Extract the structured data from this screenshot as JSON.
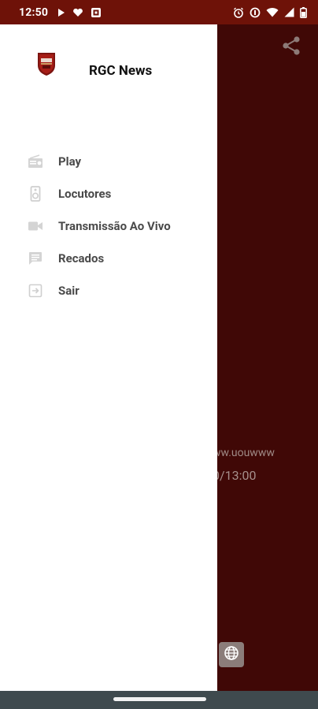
{
  "status_bar": {
    "time": "12:50",
    "left_icons": [
      "play-icon",
      "heart-shield-icon",
      "app-badge-icon"
    ],
    "right_icons": [
      "alarm-icon",
      "data-saver-icon",
      "wifi-icon",
      "signal-icon",
      "battery-icon"
    ]
  },
  "drawer": {
    "app_title": "RGC News",
    "menu_items": [
      {
        "label": "Play",
        "icon": "radio-icon"
      },
      {
        "label": "Locutores",
        "icon": "speaker-icon"
      },
      {
        "label": "Transmissão Ao Vivo",
        "icon": "videocam-icon"
      },
      {
        "label": "Recados",
        "icon": "message-icon"
      },
      {
        "label": "Sair",
        "icon": "exit-icon"
      }
    ]
  },
  "background": {
    "url_text": "ww.uouwww",
    "time_text": "0/13:00",
    "share_icon": "share-icon",
    "globe_icon": "globe-icon"
  },
  "colors": {
    "status_bar": "#6e1208",
    "backdrop": "#400806",
    "drawer": "#ffffff",
    "nav_bar": "#3f4a4e"
  }
}
